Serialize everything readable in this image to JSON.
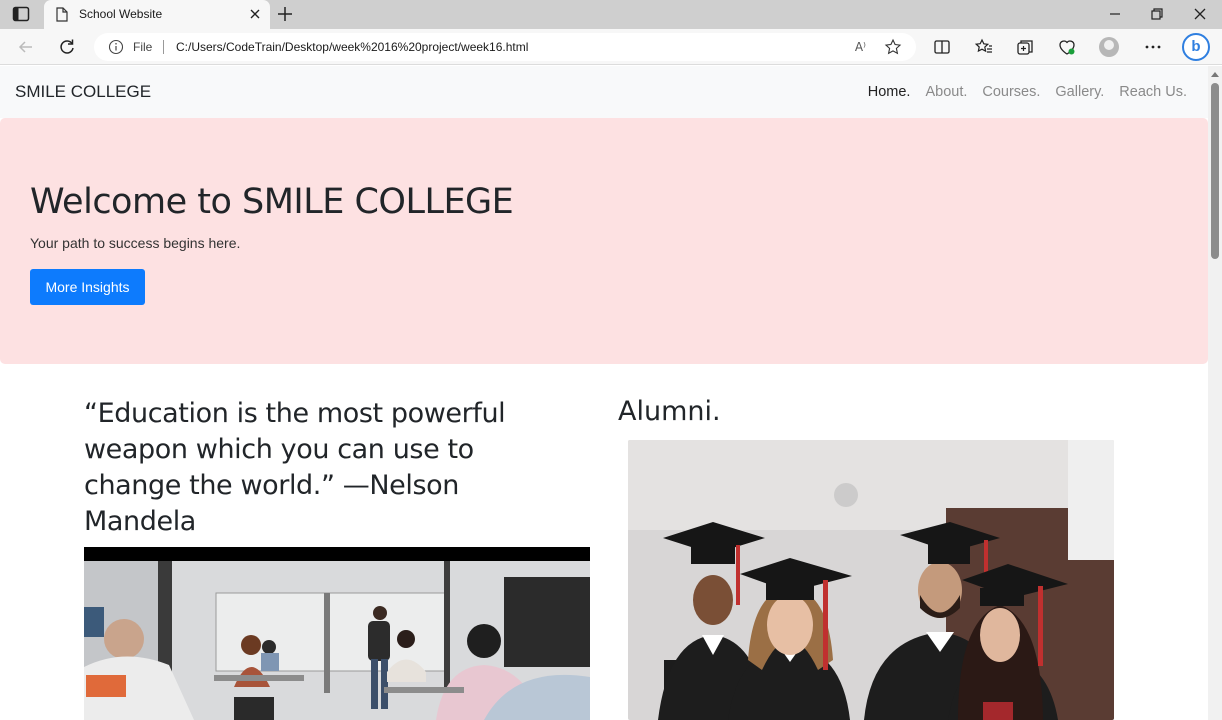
{
  "browser": {
    "tab_title": "School Website",
    "address_prefix": "File",
    "url": "C:/Users/CodeTrain/Desktop/week%2016%20project/week16.html",
    "read_aloud_label": "A⁾",
    "bing_label": "b"
  },
  "navbar": {
    "brand": "SMILE COLLEGE",
    "links": [
      "Home.",
      "About.",
      "Courses.",
      "Gallery.",
      "Reach Us."
    ]
  },
  "hero": {
    "title": "Welcome to SMILE COLLEGE",
    "subtitle": "Your path to success begins here.",
    "button_label": "More Insights"
  },
  "main": {
    "quote": "“Education is the most powerful weapon which you can use to change the world.” —Nelson Mandela",
    "alumni_heading": "Alumni."
  },
  "colors": {
    "hero_bg": "#fde1e2",
    "button_bg": "#0d7bfd",
    "navbar_bg": "#f8f9fa"
  }
}
